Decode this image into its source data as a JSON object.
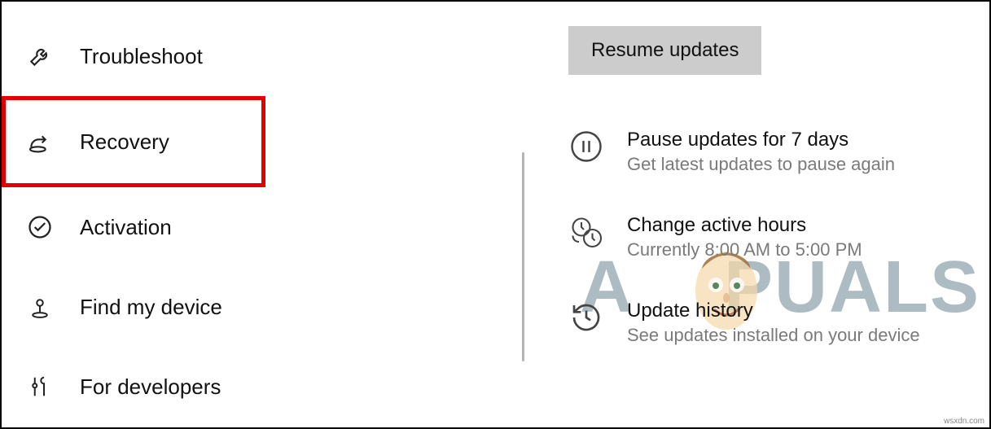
{
  "sidebar": {
    "items": [
      {
        "label": "Troubleshoot"
      },
      {
        "label": "Recovery"
      },
      {
        "label": "Activation"
      },
      {
        "label": "Find my device"
      },
      {
        "label": "For developers"
      }
    ]
  },
  "main": {
    "resume_button": "Resume updates",
    "options": [
      {
        "title": "Pause updates for 7 days",
        "subtitle": "Get latest updates to pause again"
      },
      {
        "title": "Change active hours",
        "subtitle": "Currently 8:00 AM to 5:00 PM"
      },
      {
        "title": "Update history",
        "subtitle": "See updates installed on your device"
      }
    ]
  },
  "watermark": {
    "brand_left": "A",
    "brand_right": "PUALS"
  },
  "attribution": "wsxdn.com"
}
